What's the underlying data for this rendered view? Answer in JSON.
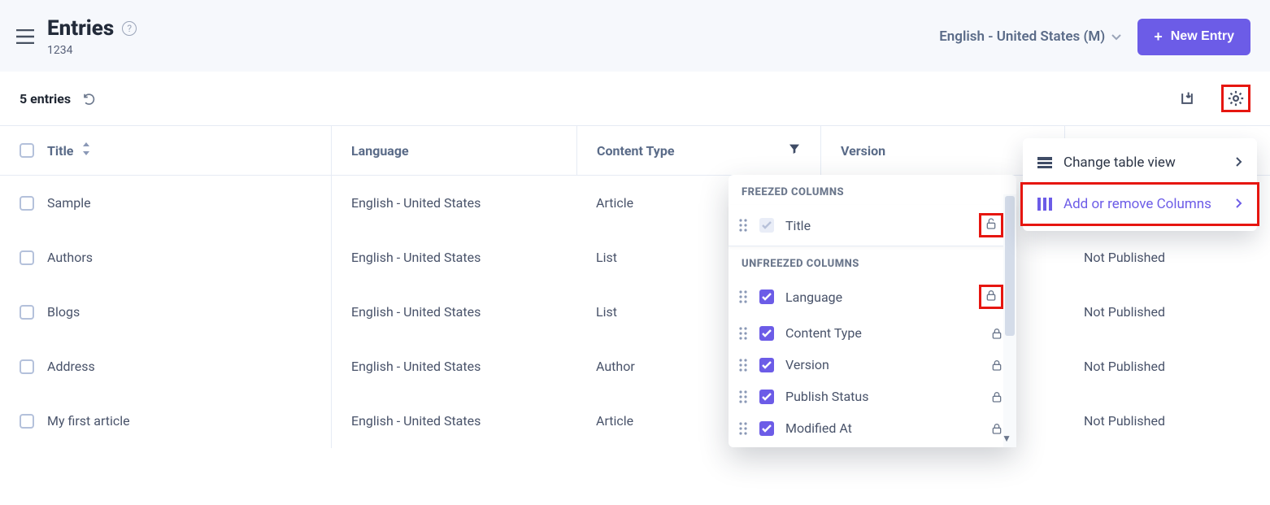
{
  "header": {
    "title": "Entries",
    "subtitle": "1234",
    "locale": "English - United States (M)",
    "new_entry_label": "New Entry"
  },
  "subheader": {
    "count_label": "5 entries"
  },
  "table": {
    "columns": {
      "title": "Title",
      "language": "Language",
      "content_type": "Content Type",
      "version": "Version"
    },
    "rows": [
      {
        "title": "Sample",
        "language": "English - United States",
        "content_type": "Article",
        "version": "",
        "publish_status": ""
      },
      {
        "title": "Authors",
        "language": "English - United States",
        "content_type": "List",
        "version": "",
        "publish_status": "Not Published"
      },
      {
        "title": "Blogs",
        "language": "English - United States",
        "content_type": "List",
        "version": "",
        "publish_status": "Not Published"
      },
      {
        "title": "Address",
        "language": "English - United States",
        "content_type": "Author",
        "version": "",
        "publish_status": "Not Published"
      },
      {
        "title": "My first article",
        "language": "English - United States",
        "content_type": "Article",
        "version": "",
        "publish_status": "Not Published"
      }
    ]
  },
  "gear_menu": {
    "change_view": "Change table view",
    "add_remove": "Add or remove Columns"
  },
  "columns_panel": {
    "freezed_label": "FREEZED COLUMNS",
    "unfreezed_label": "UNFREEZED COLUMNS",
    "freezed": [
      {
        "label": "Title",
        "checked": true,
        "locked": false,
        "highlighted_unlock": true
      }
    ],
    "unfreezed": [
      {
        "label": "Language",
        "checked": true,
        "highlighted_lock": true
      },
      {
        "label": "Content Type",
        "checked": true
      },
      {
        "label": "Version",
        "checked": true
      },
      {
        "label": "Publish Status",
        "checked": true
      },
      {
        "label": "Modified At",
        "checked": true
      }
    ]
  },
  "colors": {
    "accent": "#6c5ce7",
    "highlight": "#e61610"
  }
}
